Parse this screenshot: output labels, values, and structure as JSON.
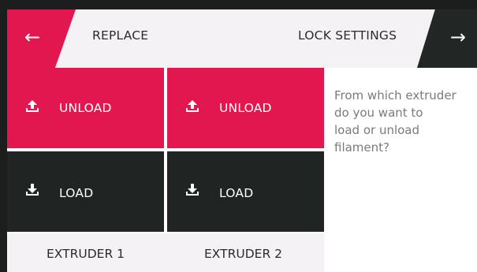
{
  "header": {
    "back_icon": "←",
    "title": "REPLACE",
    "lock_settings": "LOCK SETTINGS",
    "next_icon": "→"
  },
  "colors": {
    "accent": "#e3174f",
    "dark": "#202523",
    "light_bg": "#f5f2f5"
  },
  "extruders": [
    {
      "unload_label": "UNLOAD",
      "load_label": "LOAD",
      "name": "EXTRUDER 1"
    },
    {
      "unload_label": "UNLOAD",
      "load_label": "LOAD",
      "name": "EXTRUDER 2"
    }
  ],
  "question": "From which extruder\ndo you want to\nload or unload\nfilament?"
}
